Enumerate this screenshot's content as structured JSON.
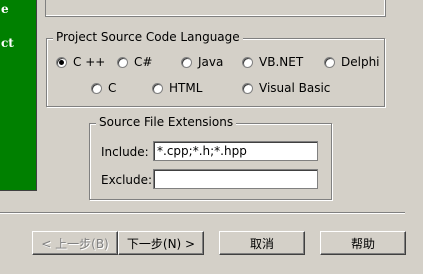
{
  "left_panel": {
    "fragments": [
      "e",
      "ct"
    ]
  },
  "language_group": {
    "title": "Project Source Code Language",
    "options": [
      {
        "label": "C ++",
        "selected": true
      },
      {
        "label": "C#",
        "selected": false
      },
      {
        "label": "Java",
        "selected": false
      },
      {
        "label": "VB.NET",
        "selected": false
      },
      {
        "label": "Delphi",
        "selected": false
      },
      {
        "label": "C",
        "selected": false
      },
      {
        "label": "HTML",
        "selected": false
      },
      {
        "label": "Visual Basic",
        "selected": false
      }
    ]
  },
  "extensions_group": {
    "title": "Source File Extensions",
    "include_label": "Include:",
    "include_value": "*.cpp;*.h;*.hpp",
    "exclude_label": "Exclude:",
    "exclude_value": ""
  },
  "buttons": {
    "back": "< 上一步(B)",
    "next": "下一步(N) >",
    "cancel": "取消",
    "help": "帮助"
  }
}
